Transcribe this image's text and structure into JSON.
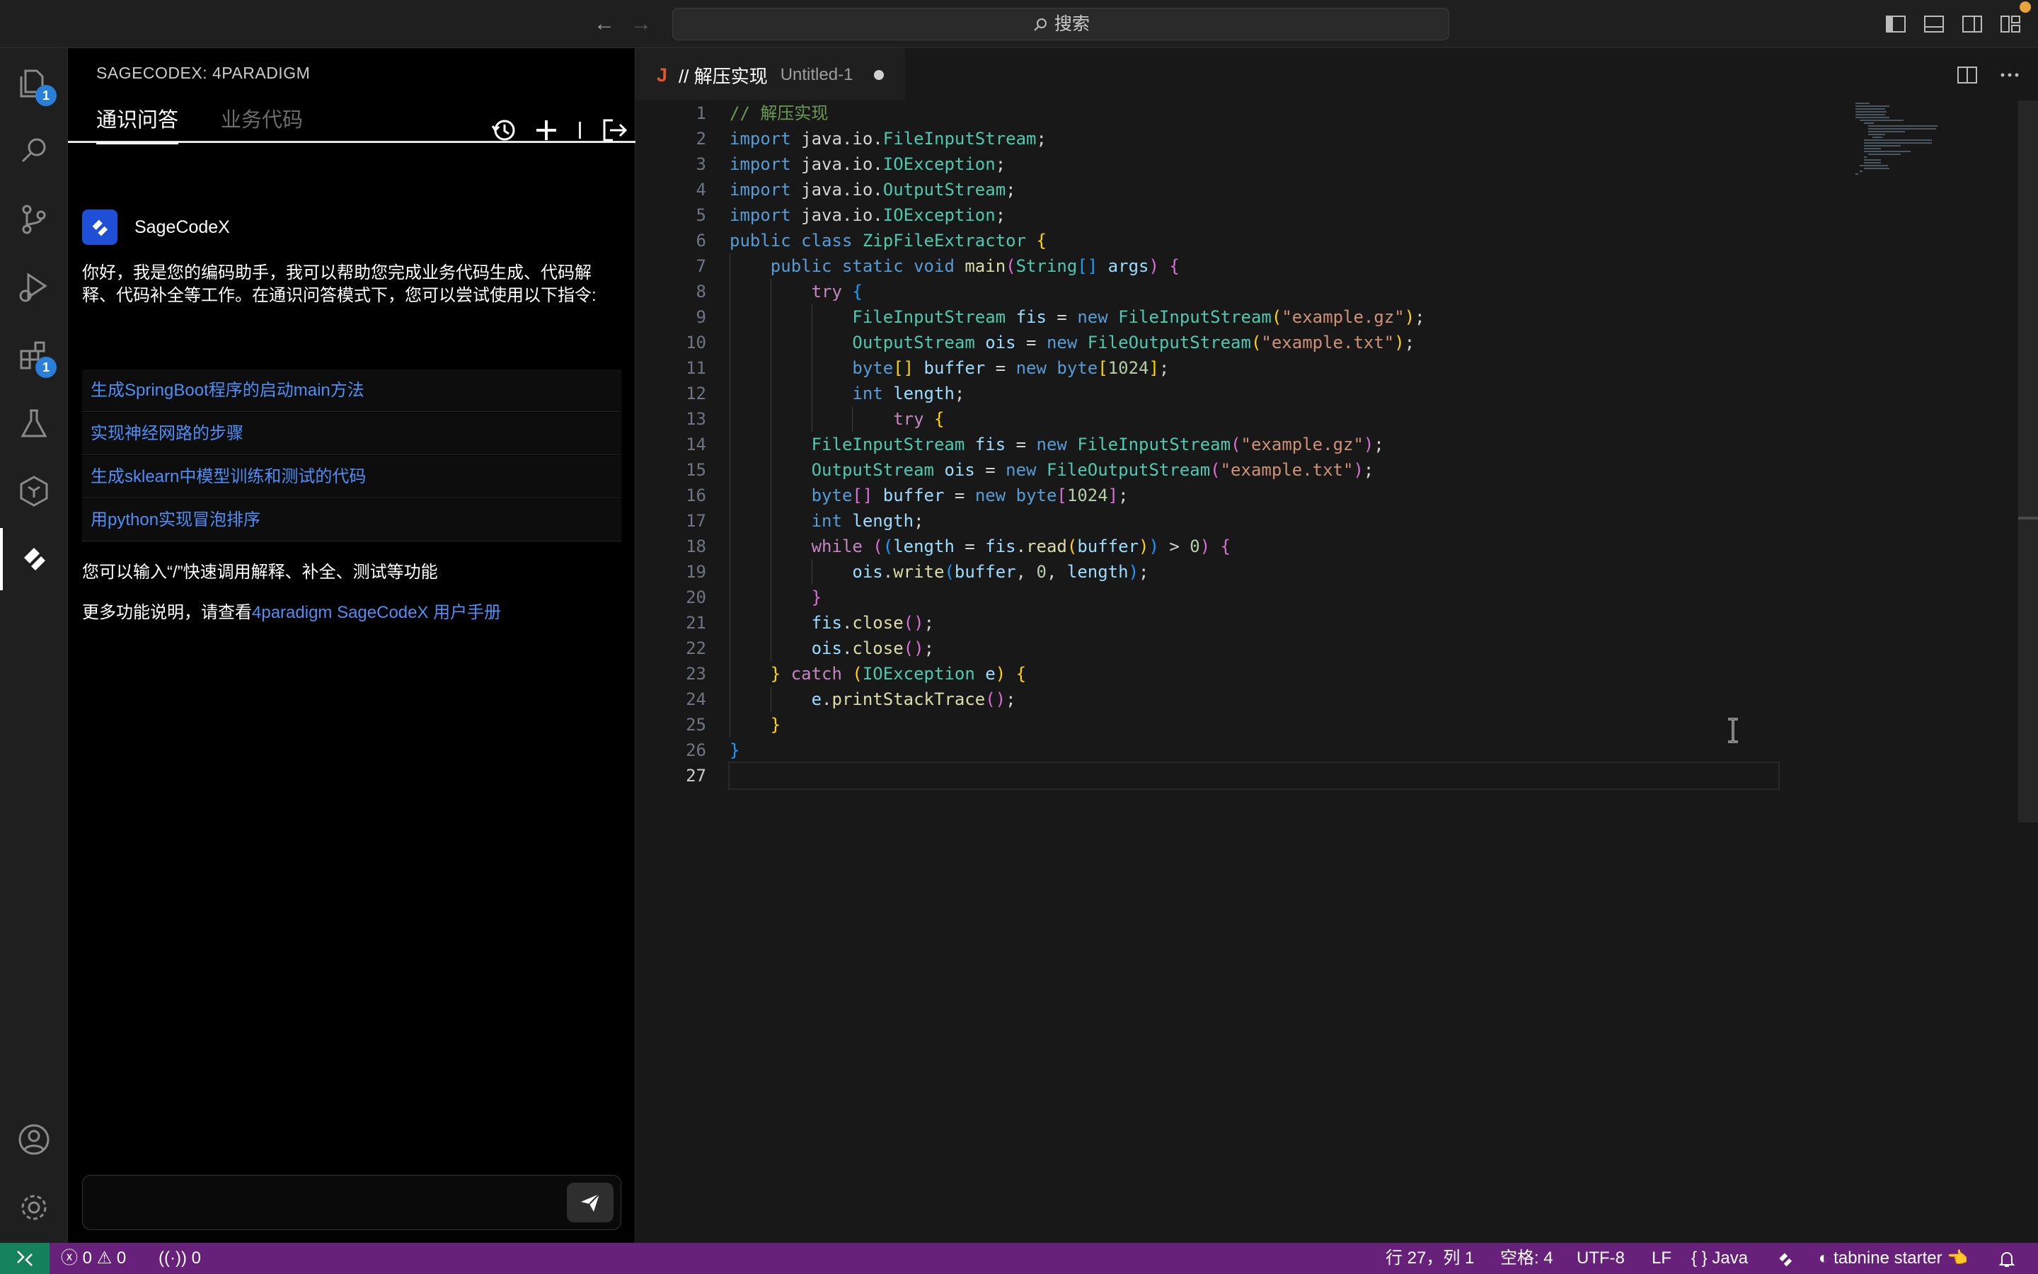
{
  "titlebar": {
    "search_label": "搜索"
  },
  "activity": {
    "explorer_badge": "1",
    "extensions_badge": "1"
  },
  "panel": {
    "header": "SAGECODEX: 4PARADIGM",
    "tab_qa": "通识问答",
    "tab_biz": "业务代码",
    "assistant_name": "SageCodeX",
    "intro": "你好，我是您的编码助手，我可以帮助您完成业务代码生成、代码解释、代码补全等工作。在通识问答模式下，您可以尝试使用以下指令:",
    "suggestions": [
      "生成SpringBoot程序的启动main方法",
      "实现神经网路的步骤",
      "生成sklearn中模型训练和测试的代码",
      "用python实现冒泡排序"
    ],
    "slash_tip": "您可以输入“/”快速调用解释、补全、测试等功能",
    "manual_prefix": "更多功能说明，请查看",
    "manual_link": "4paradigm SageCodeX 用户手册",
    "input_value": ""
  },
  "editor": {
    "tab_icon": "J",
    "tab_title": "// 解压实现",
    "tab_file": "Untitled-1",
    "line_numbers": [
      "1",
      "2",
      "3",
      "4",
      "5",
      "6",
      "7",
      "8",
      "9",
      "10",
      "11",
      "12",
      "13",
      "14",
      "15",
      "16",
      "17",
      "18",
      "19",
      "20",
      "21",
      "22",
      "23",
      "24",
      "25",
      "26",
      "27"
    ],
    "current_line": 27,
    "code_lines": [
      "// 解压实现",
      "import java.io.FileInputStream;",
      "import java.io.IOException;",
      "import java.io.OutputStream;",
      "import java.io.IOException;",
      "public class ZipFileExtractor {",
      "    public static void main(String[] args) {",
      "        try {",
      "            FileInputStream fis = new FileInputStream(\"example.gz\");",
      "            OutputStream ois = new FileOutputStream(\"example.txt\");",
      "            byte[] buffer = new byte[1024];",
      "            int length;",
      "                try {",
      "        FileInputStream fis = new FileInputStream(\"example.gz\");",
      "        OutputStream ois = new FileOutputStream(\"example.txt\");",
      "        byte[] buffer = new byte[1024];",
      "        int length;",
      "        while ((length = fis.read(buffer)) > 0) {",
      "            ois.write(buffer, 0, length);",
      "        }",
      "        fis.close();",
      "        ois.close();",
      "    } catch (IOException e) {",
      "        e.printStackTrace();",
      "    }",
      "}",
      ""
    ]
  },
  "statusbar": {
    "errors": "0",
    "warnings": "0",
    "ports": "0",
    "position": "行 27，列 1",
    "indent": "空格: 4",
    "encoding": "UTF-8",
    "eol": "LF",
    "language_braces": "{ }",
    "language": "Java",
    "tabnine": "tabnine starter",
    "tabnine_emoji": "👈"
  }
}
